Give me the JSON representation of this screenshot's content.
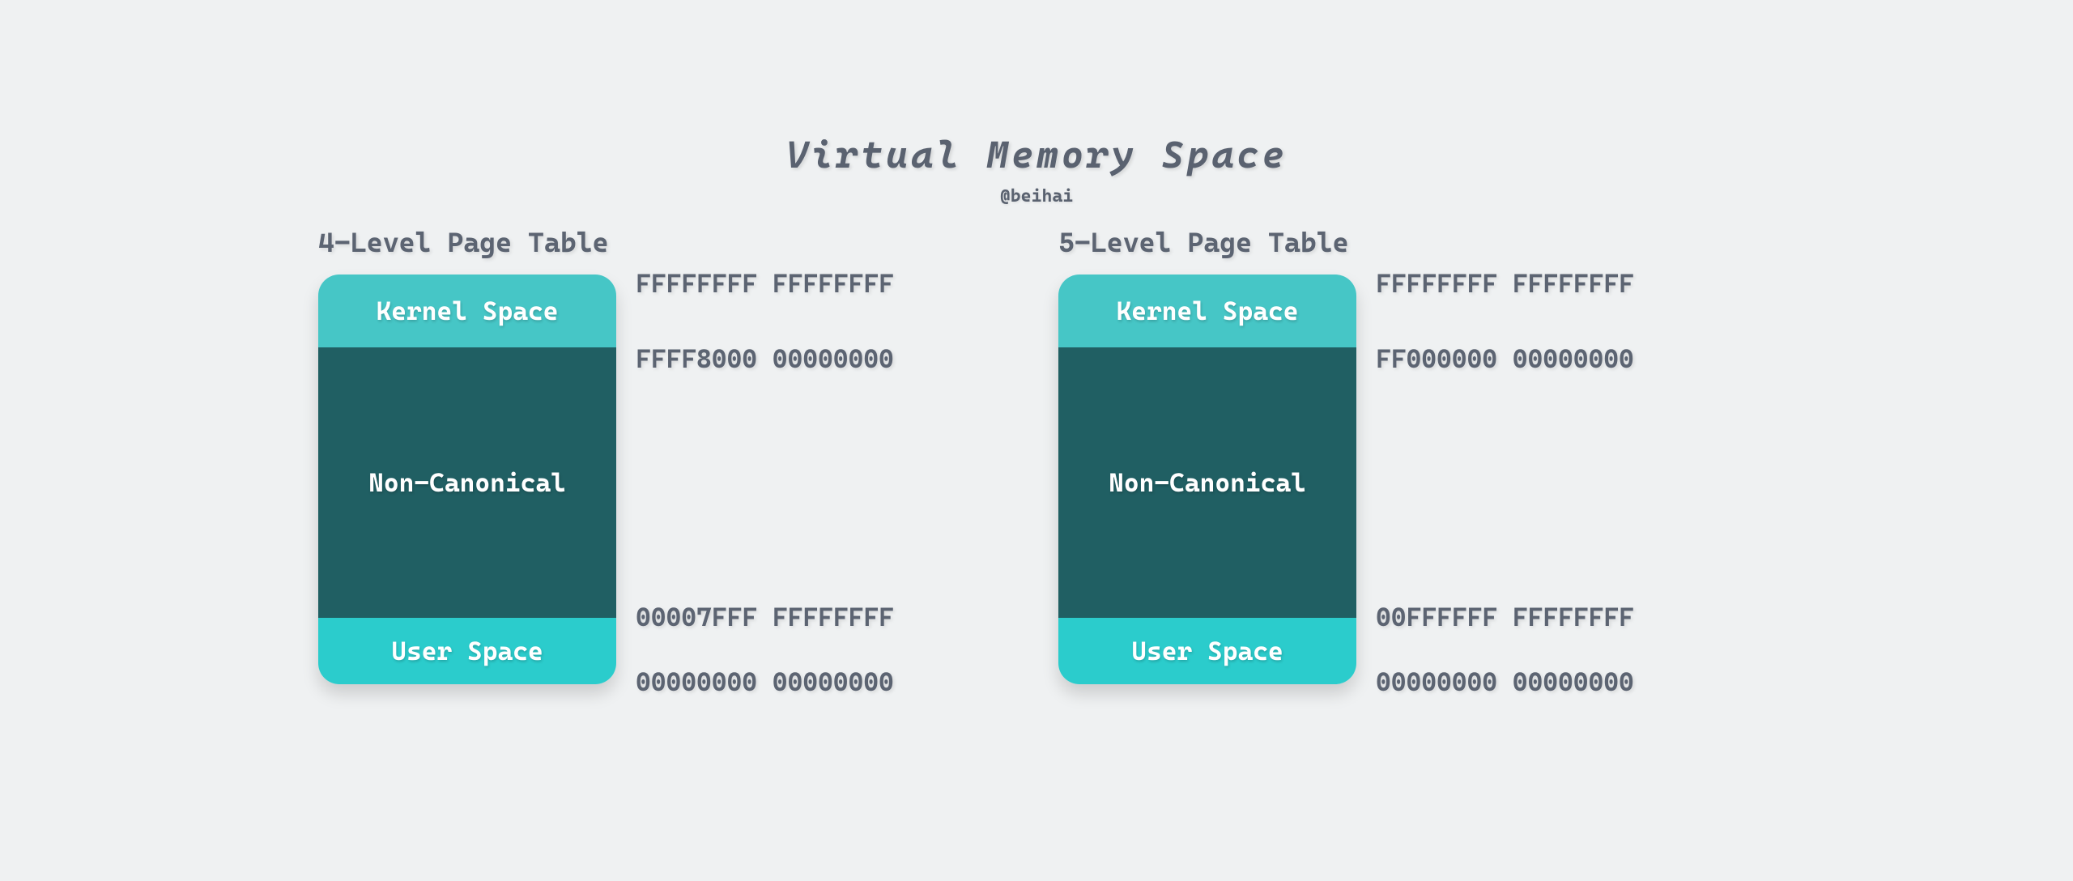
{
  "title": "Virtual Memory Space",
  "subtitle": "@beihai",
  "segment_labels": {
    "kernel": "Kernel Space",
    "noncanonical": "Non-Canonical",
    "user": "User Space"
  },
  "panels": [
    {
      "title": "4-Level Page Table",
      "addresses": {
        "top": "FFFFFFFF FFFFFFFF",
        "kernel_end": "FFFF8000 00000000",
        "user_start": "00007FFF FFFFFFFF",
        "bottom": "00000000 00000000"
      }
    },
    {
      "title": "5-Level Page Table",
      "addresses": {
        "top": "FFFFFFFF FFFFFFFF",
        "kernel_end": "FF000000 00000000",
        "user_start": "00FFFFFF FFFFFFFF",
        "bottom": "00000000 00000000"
      }
    }
  ]
}
